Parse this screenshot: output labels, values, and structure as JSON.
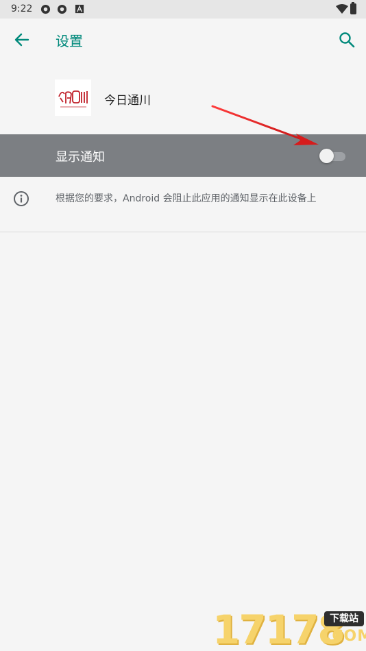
{
  "status_bar": {
    "time": "9:22",
    "icons": [
      "sync-icon",
      "sync-icon",
      "a-badge-icon",
      "wifi-icon",
      "battery-charging-icon"
    ]
  },
  "app_bar": {
    "title": "设置",
    "back_icon": "arrow-left-icon",
    "search_icon": "search-icon",
    "accent_color": "#00897b"
  },
  "app_header": {
    "name": "今日通川",
    "logo_text": "今日通川"
  },
  "settings": {
    "show_notifications_label": "显示通知",
    "show_notifications_enabled": false,
    "row_highlight_color": "#7c7f83"
  },
  "info": {
    "icon": "info-icon",
    "text": "根据您的要求，Android 会阻止此应用的通知显示在此设备上"
  },
  "annotation": {
    "arrow_color": "#e02020"
  },
  "watermark": {
    "digits": "17178",
    "badge": "下载站",
    "suffix": ".COM"
  }
}
